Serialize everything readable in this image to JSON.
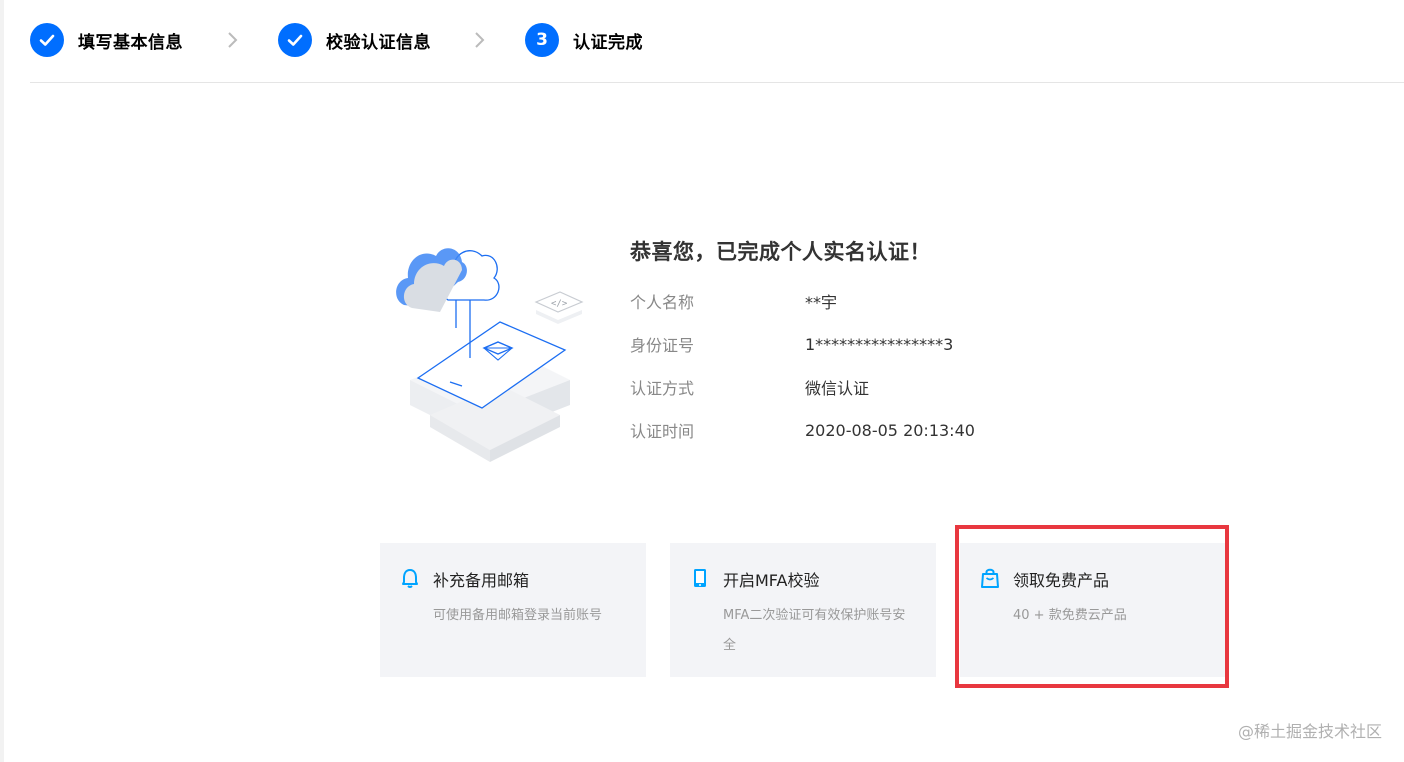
{
  "steps": [
    {
      "label": "填写基本信息",
      "state": "done"
    },
    {
      "label": "校验认证信息",
      "state": "done"
    },
    {
      "label": "认证完成",
      "state": "current",
      "number": "3"
    }
  ],
  "result": {
    "title": "恭喜您，已完成个人实名认证！",
    "rows": [
      {
        "key": "个人名称",
        "value": "**宇"
      },
      {
        "key": "身份证号",
        "value": "1****************3"
      },
      {
        "key": "认证方式",
        "value": "微信认证"
      },
      {
        "key": "认证时间",
        "value": "2020-08-05 20:13:40"
      }
    ]
  },
  "cards": [
    {
      "title": "补充备用邮箱",
      "desc": "可使用备用邮箱登录当前账号",
      "icon": "bell-icon"
    },
    {
      "title": "开启MFA校验",
      "desc": "MFA二次验证可有效保护账号安全",
      "icon": "phone-icon"
    },
    {
      "title": "领取免费产品",
      "desc": "40 + 款免费云产品",
      "icon": "shopping-bag-icon"
    }
  ],
  "watermark": "@稀土掘金技术社区",
  "colors": {
    "accent": "#006eff",
    "highlight": "#e8373f",
    "card_bg": "#f3f4f7"
  }
}
